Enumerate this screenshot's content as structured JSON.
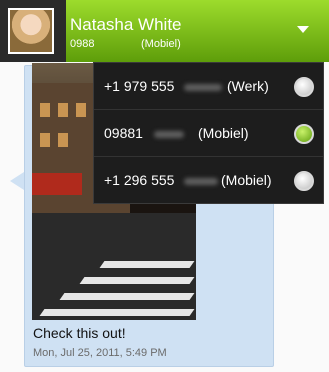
{
  "header": {
    "contact_name": "Natasha White",
    "contact_number": "0988",
    "contact_number_type": "(Mobiel)",
    "dropdown_icon": "chevron-down-icon",
    "avatar_icon": "contact-photo"
  },
  "conversation": {
    "message_caption": "Check this out!",
    "message_timestamp": "Mon, Jul 25, 2011, 5:49 PM",
    "image_icon": "street-photo"
  },
  "number_menu": {
    "items": [
      {
        "number": "+1 979 555",
        "type": "(Werk)",
        "selected": false
      },
      {
        "number": "09881",
        "type": "(Mobiel)",
        "selected": true
      },
      {
        "number": "+1 296 555",
        "type": "(Mobiel)",
        "selected": false
      }
    ]
  },
  "colors": {
    "header_green": "#7cc11c",
    "bubble_blue": "#cfe1f3",
    "menu_bg": "#1d1d1d",
    "radio_selected": "#6fb312"
  }
}
